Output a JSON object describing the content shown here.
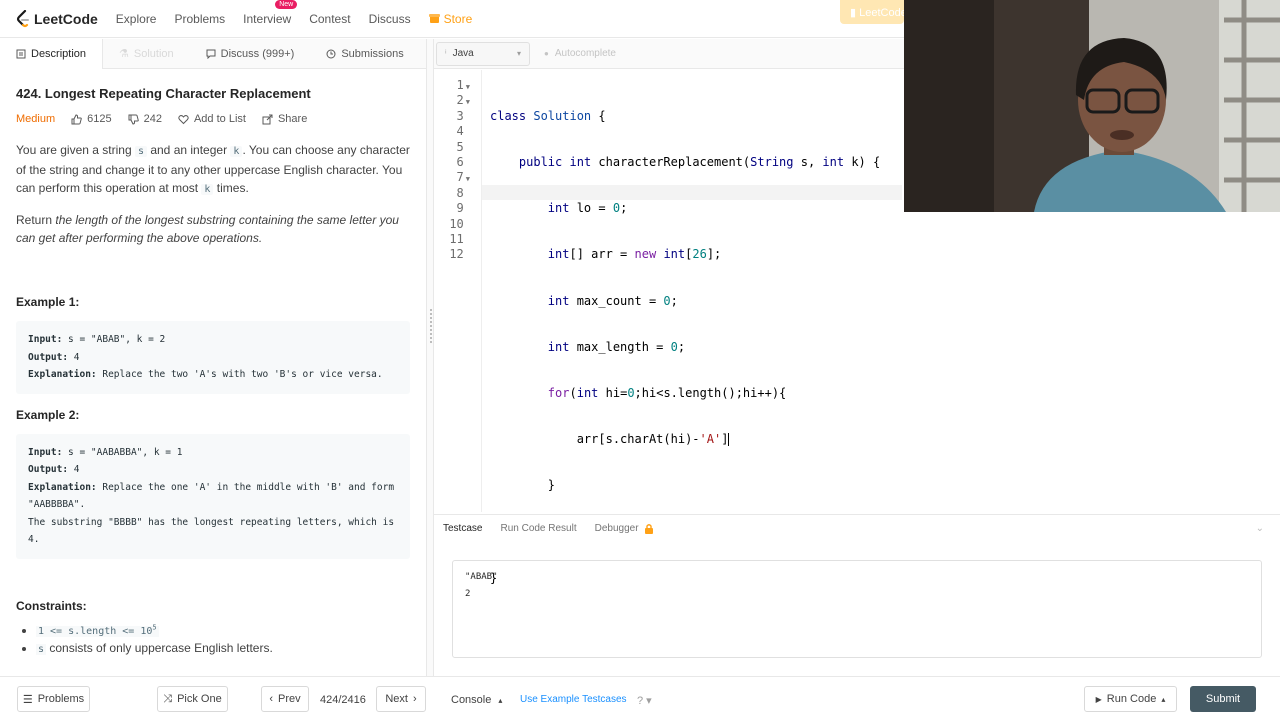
{
  "nav": {
    "brand": "LeetCode",
    "items": [
      "Explore",
      "Problems",
      "Interview",
      "Contest",
      "Discuss"
    ],
    "interview_badge": "New",
    "store": "Store",
    "premium": "LeetCode"
  },
  "left_tabs": {
    "description": "Description",
    "solution": "Solution",
    "discuss": "Discuss (999+)",
    "submissions": "Submissions"
  },
  "problem": {
    "title": "424. Longest Repeating Character Replacement",
    "difficulty": "Medium",
    "likes": "6125",
    "dislikes": "242",
    "add_to_list": "Add to List",
    "share": "Share",
    "p1_a": "You are given a string ",
    "p1_code1": "s",
    "p1_b": " and an integer ",
    "p1_code2": "k",
    "p1_c": ". You can choose any character of the string and change it to any other uppercase English character. You can perform this operation at most ",
    "p1_code3": "k",
    "p1_d": " times.",
    "p2_a": "Return ",
    "p2_em": "the length of the longest substring containing the same letter you can get after performing the above operations.",
    "example1_title": "Example 1:",
    "ex1_input_label": "Input:",
    "ex1_input": " s = \"ABAB\", k = 2",
    "ex1_output_label": "Output:",
    "ex1_output": " 4",
    "ex1_expl_label": "Explanation:",
    "ex1_expl": " Replace the two 'A's with two 'B's or vice versa.",
    "example2_title": "Example 2:",
    "ex2_input_label": "Input:",
    "ex2_input": " s = \"AABABBA\", k = 1",
    "ex2_output_label": "Output:",
    "ex2_output": " 4",
    "ex2_expl_label": "Explanation:",
    "ex2_expl": " Replace the one 'A' in the middle with 'B' and form \"AABBBBA\".\nThe substring \"BBBB\" has the longest repeating letters, which is 4.",
    "constraints_title": "Constraints:",
    "c1_code": "1 <= s.length <= 10",
    "c1_sup": "5",
    "c2_code": "s",
    "c2_text": " consists of only uppercase English letters."
  },
  "editor": {
    "language": "Java",
    "autocomplete": "Autocomplete",
    "line_numbers": [
      "1",
      "2",
      "3",
      "4",
      "5",
      "6",
      "7",
      "8",
      "9",
      "10",
      "11",
      "12"
    ]
  },
  "console": {
    "tab_testcase": "Testcase",
    "tab_result": "Run Code Result",
    "tab_debugger": "Debugger",
    "testcase_line1": "\"ABAB\"",
    "testcase_line2": "2"
  },
  "footer": {
    "problems": "Problems",
    "pick_one": "Pick One",
    "prev": "Prev",
    "page": "424/2416",
    "next": "Next",
    "console": "Console",
    "use_example": "Use Example Testcases",
    "run_code": "Run Code",
    "submit": "Submit"
  },
  "colors": {
    "accent": "#ffa116",
    "difficulty_medium": "#ef6c00",
    "submit_bg": "#455a64",
    "link": "#1a90ff"
  }
}
